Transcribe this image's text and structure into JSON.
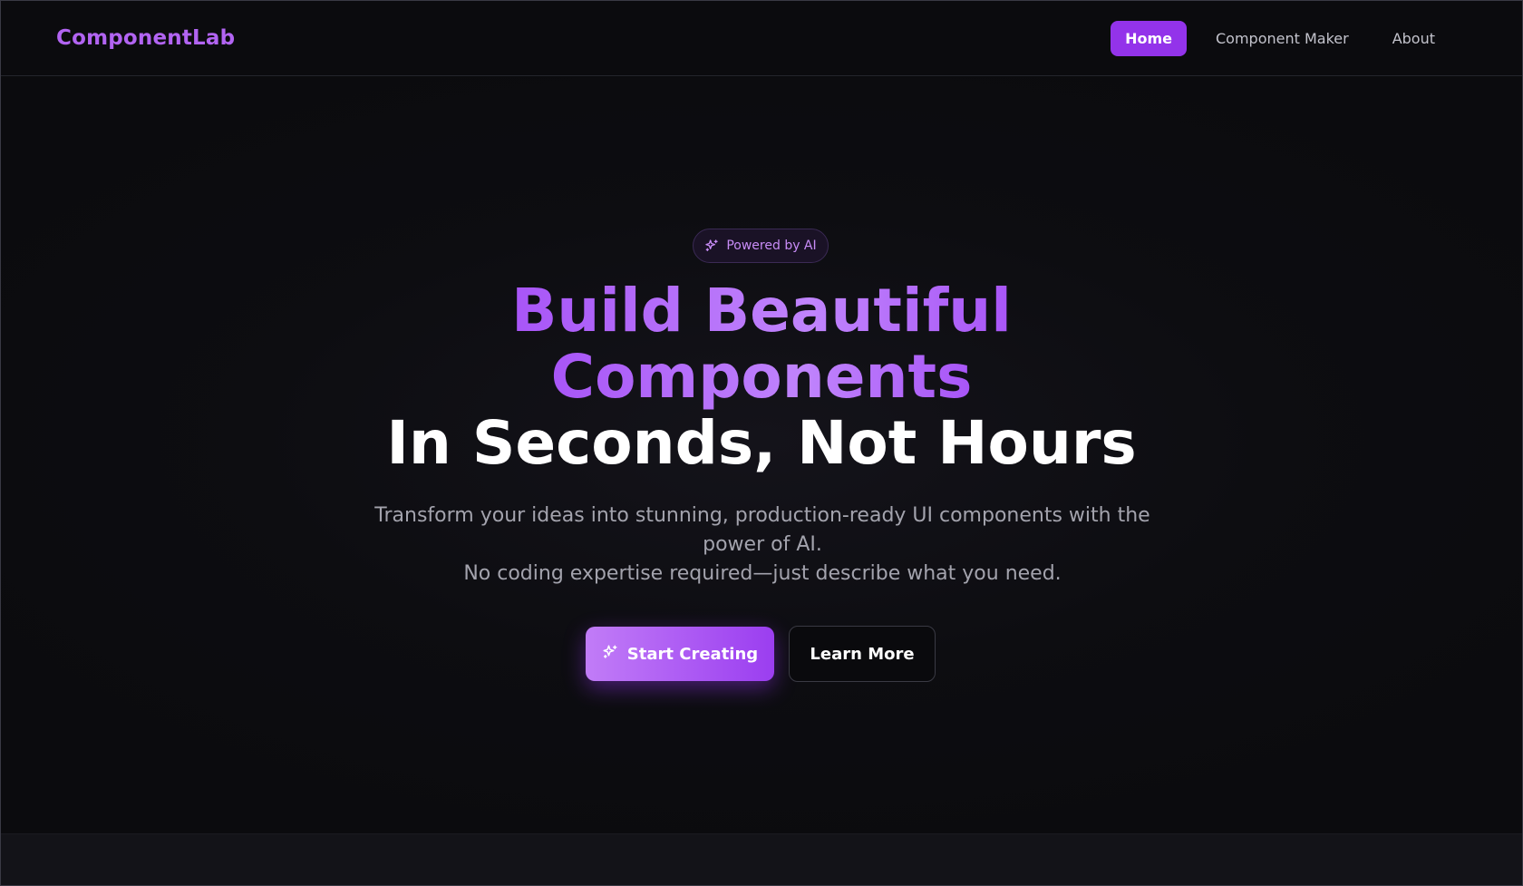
{
  "nav": {
    "brand": "ComponentLab",
    "links": [
      {
        "label": "Home",
        "active": true
      },
      {
        "label": "Component Maker",
        "active": false
      },
      {
        "label": "About",
        "active": false
      }
    ]
  },
  "hero": {
    "badge": {
      "icon": "sparkles-icon",
      "label": "Powered by AI"
    },
    "headline_line1": "Build Beautiful",
    "headline_line2": "Components",
    "headline_line3": "In Seconds, Not Hours",
    "subtitle_line1": "Transform your ideas into stunning, production-ready UI components with the power of AI.",
    "subtitle_line2": "No coding expertise required—just describe what you need.",
    "primary_button": {
      "icon": "sparkles-icon",
      "label": "Start Creating"
    },
    "secondary_button": {
      "label": "Learn More"
    }
  },
  "colors": {
    "accent": "#9333ea",
    "accent_light": "#c084fc",
    "background": "#0b0b0e",
    "text_muted": "#a3a3ad"
  }
}
